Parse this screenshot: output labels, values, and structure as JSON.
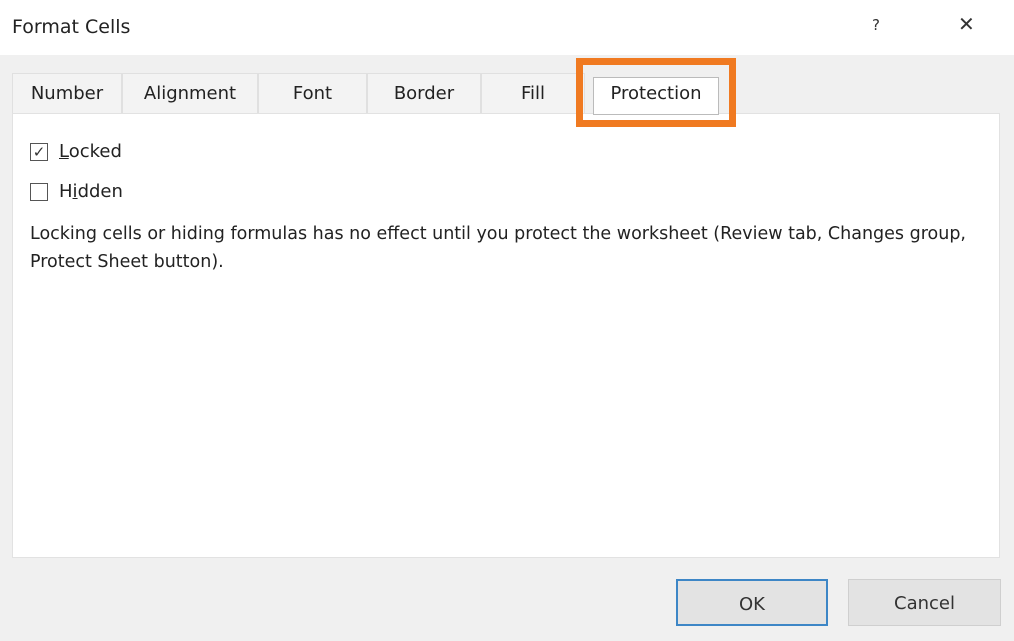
{
  "dialog": {
    "title": "Format Cells",
    "help_label": "?",
    "close_label": "✕"
  },
  "tabs": [
    {
      "label": "Number"
    },
    {
      "label": "Alignment"
    },
    {
      "label": "Font"
    },
    {
      "label": "Border"
    },
    {
      "label": "Fill"
    },
    {
      "label": "Protection",
      "selected": true
    }
  ],
  "highlight_color": "#f07a21",
  "protection": {
    "locked": {
      "label_accel": "L",
      "label_rest": "ocked",
      "checked": true
    },
    "hidden": {
      "label_pre": "H",
      "label_accel": "i",
      "label_rest": "dden",
      "checked": false
    },
    "note": "Locking cells or hiding formulas has no effect until you protect the worksheet (Review tab, Changes group, Protect Sheet button)."
  },
  "buttons": {
    "ok": "OK",
    "cancel": "Cancel"
  }
}
